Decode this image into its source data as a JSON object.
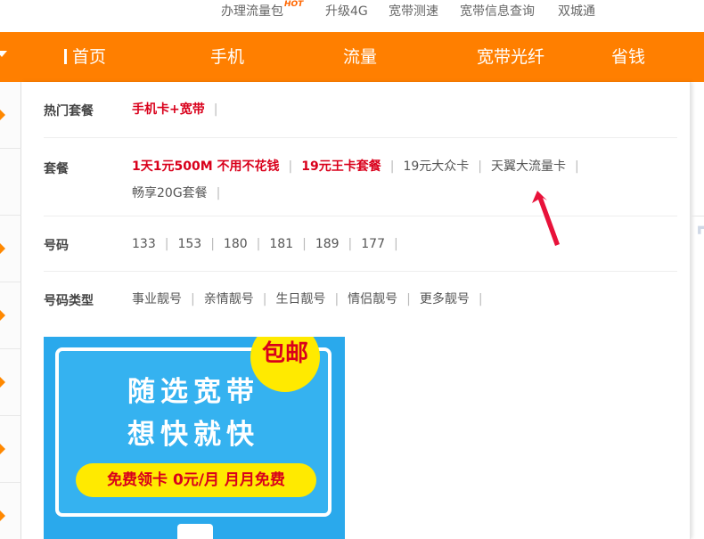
{
  "top_links": [
    {
      "label": "办理流量包",
      "badge": "HOT"
    },
    {
      "label": "升级4G"
    },
    {
      "label": "宽带测速"
    },
    {
      "label": "宽带信息查询"
    },
    {
      "label": "双城通"
    }
  ],
  "nav": {
    "items": [
      "首页",
      "手机",
      "流量",
      "宽带光纤",
      "省钱"
    ]
  },
  "rows": [
    {
      "label": "热门套餐",
      "items": [
        {
          "text": "手机卡+宽带",
          "hot": true
        }
      ]
    },
    {
      "label": "套餐",
      "items": [
        {
          "text": "1天1元500M 不用不花钱",
          "hot": true
        },
        {
          "text": "19元王卡套餐",
          "hot": true
        },
        {
          "text": "19元大众卡",
          "hot": false
        },
        {
          "text": "天翼大流量卡",
          "hot": false
        },
        {
          "text": "畅享20G套餐",
          "hot": false
        }
      ]
    },
    {
      "label": "号码",
      "items": [
        {
          "text": "133"
        },
        {
          "text": "153"
        },
        {
          "text": "180"
        },
        {
          "text": "181"
        },
        {
          "text": "189"
        },
        {
          "text": "177"
        }
      ]
    },
    {
      "label": "号码类型",
      "items": [
        {
          "text": "事业靓号"
        },
        {
          "text": "亲情靓号"
        },
        {
          "text": "生日靓号"
        },
        {
          "text": "情侣靓号"
        },
        {
          "text": "更多靓号"
        }
      ]
    }
  ],
  "banner": {
    "line1": "随选宽带",
    "line2": "想快就快",
    "badge": "包邮",
    "pill": "免费领卡 0元/月   月月免费"
  },
  "colors": {
    "nav_bg": "#ff7f00",
    "hot_text": "#d9001b",
    "annotation": "#e8123a"
  }
}
